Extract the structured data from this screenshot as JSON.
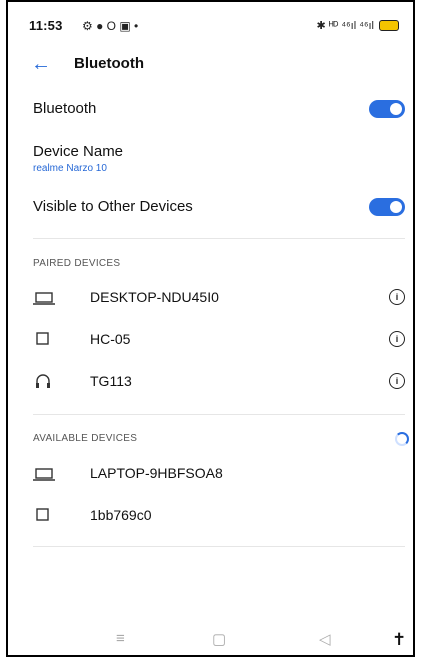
{
  "status_bar": {
    "time": "11:53",
    "left_icons": "⚙ ● O ▣ •",
    "right_icons": "✱ ᴴᴰ ⁴⁶ıl ⁴⁶ıl"
  },
  "header": {
    "title": "Bluetooth"
  },
  "settings": {
    "bluetooth_label": "Bluetooth",
    "bluetooth_on": true,
    "device_name_label": "Device Name",
    "device_name_value": "realme Narzo 10",
    "visible_label": "Visible to Other Devices",
    "visible_on": true
  },
  "paired": {
    "title": "PAIRED DEVICES",
    "devices": [
      {
        "name": "DESKTOP-NDU45I0",
        "icon": "laptop-icon"
      },
      {
        "name": "HC-05",
        "icon": "generic-device-icon"
      },
      {
        "name": "TG113",
        "icon": "headset-icon"
      }
    ]
  },
  "available": {
    "title": "AVAILABLE DEVICES",
    "devices": [
      {
        "name": "LAPTOP-9HBFSOA8",
        "icon": "laptop-icon"
      },
      {
        "name": "1bb769c0",
        "icon": "generic-device-icon"
      }
    ]
  },
  "colors": {
    "accent": "#2a6ee0",
    "link": "#2668d6"
  }
}
